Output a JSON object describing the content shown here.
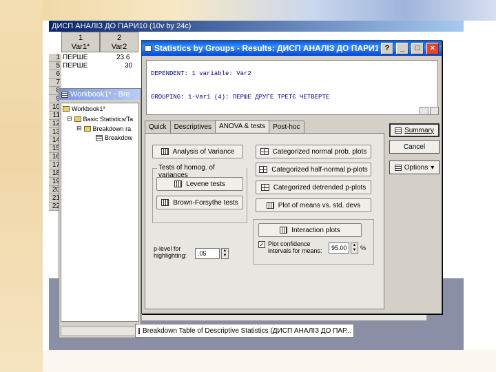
{
  "main_window": {
    "title": "ДИСП АНАЛІЗ ДО ПАРИ10 (10v by 24c)",
    "columns": [
      {
        "num": "1",
        "name": "Var1*"
      },
      {
        "num": "2",
        "name": "Var2"
      }
    ],
    "rows": [
      {
        "num": "1",
        "var1": "ПЕРШЕ",
        "var2": "23.6"
      },
      {
        "num": "5",
        "var1": "ПЕРШЕ",
        "var2": "30"
      }
    ],
    "row_numbers": [
      "6",
      "7",
      "8",
      "9",
      "10",
      "11",
      "12",
      "13",
      "14",
      "15",
      "16",
      "17",
      "18",
      "19",
      "20",
      "21",
      "22"
    ]
  },
  "workbook": {
    "title": "Workbook1* - Bre",
    "tree": [
      "Workbook1*",
      "Basic Statistics/Ta",
      "Breakdown ra",
      "Breakdow"
    ]
  },
  "status_bar": {
    "text": "Breakdown Table of Descriptive Statistics (ДИСП АНАЛІЗ ДО ПАР..."
  },
  "dialog": {
    "title": "Statistics by Groups - Results: ДИСП АНАЛІЗ ДО ПАРИ10",
    "help_btn": "?",
    "min_btn": "_",
    "max_btn": "□",
    "close_btn": "×",
    "results_lines": [
      "DEPENDENT: 1 variable: Var2",
      "GROUPING: 1-Var1      (4): ПЕРШЕ ДРУГЕ ТРЕТЄ ЧЕТВЕРТЕ"
    ],
    "tabs": [
      "Quick",
      "Descriptives",
      "ANOVA & tests",
      "Post-hoc"
    ],
    "active_tab": "ANOVA & tests",
    "buttons": {
      "analysis_of_variance": "Analysis of Variance",
      "homog_group": "Tests of homog. of variances",
      "levene": "Levene tests",
      "brown_forsythe": "Brown-Forsythe tests",
      "cat_normal": "Categorized normal prob. plots",
      "cat_half_normal": "Categorized half-normal p-plots",
      "cat_detrended": "Categorized detrended p-plots",
      "means_vs_std": "Plot of means vs. std. devs",
      "interaction": "Interaction plots"
    },
    "plevel_label": "p-level for highlighting:",
    "plevel_value": ".05",
    "plot_conf_label": "Plot confidence intervals for means:",
    "plot_conf_value": "95.00",
    "plot_conf_unit": "%",
    "side": {
      "summary": "Summary",
      "cancel": "Cancel",
      "options": "Options"
    }
  }
}
